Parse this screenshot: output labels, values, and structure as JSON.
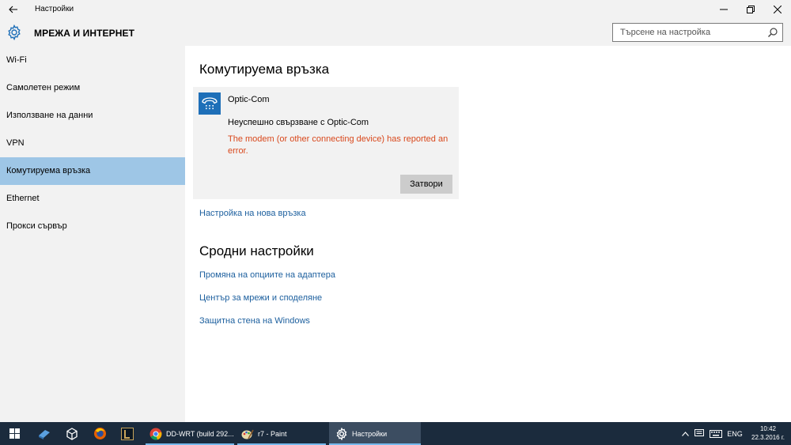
{
  "window": {
    "title": "Настройки"
  },
  "header": {
    "section_title": "МРЕЖА И ИНТЕРНЕТ",
    "search_placeholder": "Търсене на настройка"
  },
  "sidebar": {
    "items": [
      {
        "label": "Wi-Fi",
        "selected": false
      },
      {
        "label": "Самолетен режим",
        "selected": false
      },
      {
        "label": "Използване на данни",
        "selected": false
      },
      {
        "label": "VPN",
        "selected": false
      },
      {
        "label": "Комутируема връзка",
        "selected": true
      },
      {
        "label": "Ethernet",
        "selected": false
      },
      {
        "label": "Прокси сървър",
        "selected": false
      }
    ]
  },
  "main": {
    "heading": "Комутируема връзка",
    "connection": {
      "name": "Optic-Com",
      "status": "Неуспешно свързване с Optic-Com",
      "error": "The modem (or other connecting device) has reported an error.",
      "close_label": "Затвори"
    },
    "setup_link": "Настройка на нова връзка",
    "related_heading": "Сродни настройки",
    "related_links": [
      "Промяна на опциите на адаптера",
      "Център за мрежи и споделяне",
      "Защитна стена на Windows"
    ]
  },
  "taskbar": {
    "apps": [
      {
        "label": "DD-WRT (build 292...",
        "icon": "chrome-icon"
      },
      {
        "label": "r7 - Paint",
        "icon": "paint-icon"
      },
      {
        "label": "Настройки",
        "icon": "gear-icon"
      }
    ],
    "language": "ENG",
    "time": "10:42",
    "date": "22.3.2016 г."
  },
  "colors": {
    "accent": "#1e6fb8",
    "selected_nav": "#9ec6e6",
    "link": "#1c5f9e",
    "error": "#d9481c",
    "taskbar": "#1b2b3d"
  }
}
